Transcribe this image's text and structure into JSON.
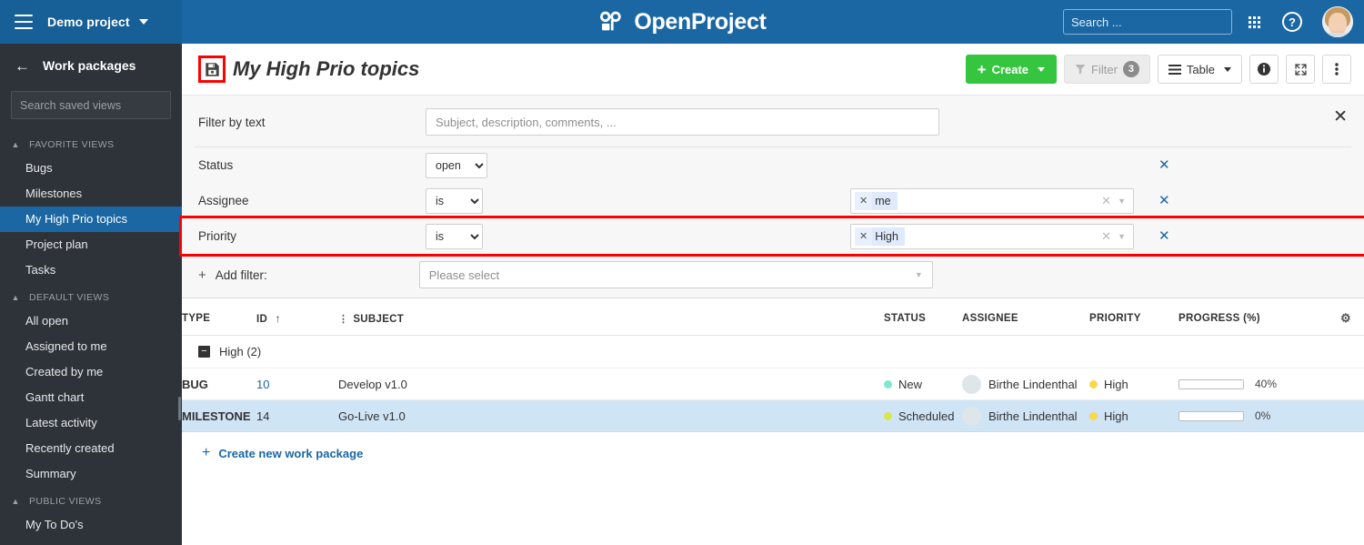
{
  "topbar": {
    "menu_icon": "hamburger-icon",
    "project_name": "Demo project",
    "logo_text": "OpenProject",
    "search_placeholder": "Search ...",
    "search_value": "",
    "grid_icon": "modules-grid-icon",
    "help_icon": "help-circle-icon",
    "avatar": "user-avatar"
  },
  "sidebar": {
    "back_icon": "arrow-left-icon",
    "title": "Work packages",
    "search_placeholder": "Search saved views",
    "search_value": "",
    "groups": [
      {
        "label": "FAVORITE VIEWS",
        "items": [
          "Bugs",
          "Milestones",
          "My High Prio topics",
          "Project plan",
          "Tasks"
        ],
        "active": "My High Prio topics"
      },
      {
        "label": "DEFAULT VIEWS",
        "items": [
          "All open",
          "Assigned to me",
          "Created by me",
          "Gantt chart",
          "Latest activity",
          "Recently created",
          "Summary"
        ],
        "active": ""
      },
      {
        "label": "PUBLIC VIEWS",
        "items": [
          "My To Do's"
        ],
        "active": ""
      }
    ]
  },
  "toolbar": {
    "save_icon": "save-floppy-icon",
    "page_title": "My High Prio topics",
    "create_label": "Create",
    "filter_label": "Filter",
    "filter_count": "3",
    "table_label": "Table",
    "info_icon": "info-icon",
    "fullscreen_icon": "fullscreen-icon",
    "more_icon": "more-vertical-icon",
    "highlight_color": "#ff0000",
    "create_color": "#35c53f"
  },
  "filters": {
    "close_icon": "close-icon",
    "text_filter": {
      "label": "Filter by text",
      "placeholder": "Subject, description, comments, ...",
      "value": ""
    },
    "rows": [
      {
        "label": "Status",
        "operator": "",
        "select_value": "open",
        "chip": "",
        "has_value_box": false,
        "highlight": false
      },
      {
        "label": "Assignee",
        "operator": "is",
        "select_value": "",
        "chip": "me",
        "has_value_box": true,
        "highlight": false
      },
      {
        "label": "Priority",
        "operator": "is",
        "select_value": "",
        "chip": "High",
        "has_value_box": true,
        "highlight": true
      }
    ],
    "add_filter": {
      "label": "Add filter:",
      "placeholder": "Please select"
    }
  },
  "table": {
    "columns": [
      "TYPE",
      "ID",
      "SUBJECT",
      "STATUS",
      "ASSIGNEE",
      "PRIORITY",
      "PROGRESS (%)"
    ],
    "sort_column": "ID",
    "sort_arrow": "↑",
    "hierarchy_icon": "hierarchy-icon",
    "settings_icon": "gear-icon",
    "group": {
      "label": "High (2)",
      "collapse_icon": "collapse-minus-icon"
    },
    "rows": [
      {
        "type": "BUG",
        "type_color": "#ff3b00",
        "id": "10",
        "subject": "Develop v1.0",
        "status": "New",
        "status_color": "#7fe6cf",
        "assignee": "Birthe Lindenthal",
        "priority": "High",
        "priority_color": "#fbd74a",
        "progress": "40%",
        "progress_value": 40,
        "selected": false
      },
      {
        "type": "MILESTONE",
        "type_color": "#32cd32",
        "id": "14",
        "subject": "Go-Live v1.0",
        "status": "Scheduled",
        "status_color": "#d6e84c",
        "assignee": "Birthe Lindenthal",
        "priority": "High",
        "priority_color": "#fbd74a",
        "progress": "0%",
        "progress_value": 0,
        "selected": true
      }
    ],
    "create_link": "Create new work package"
  }
}
